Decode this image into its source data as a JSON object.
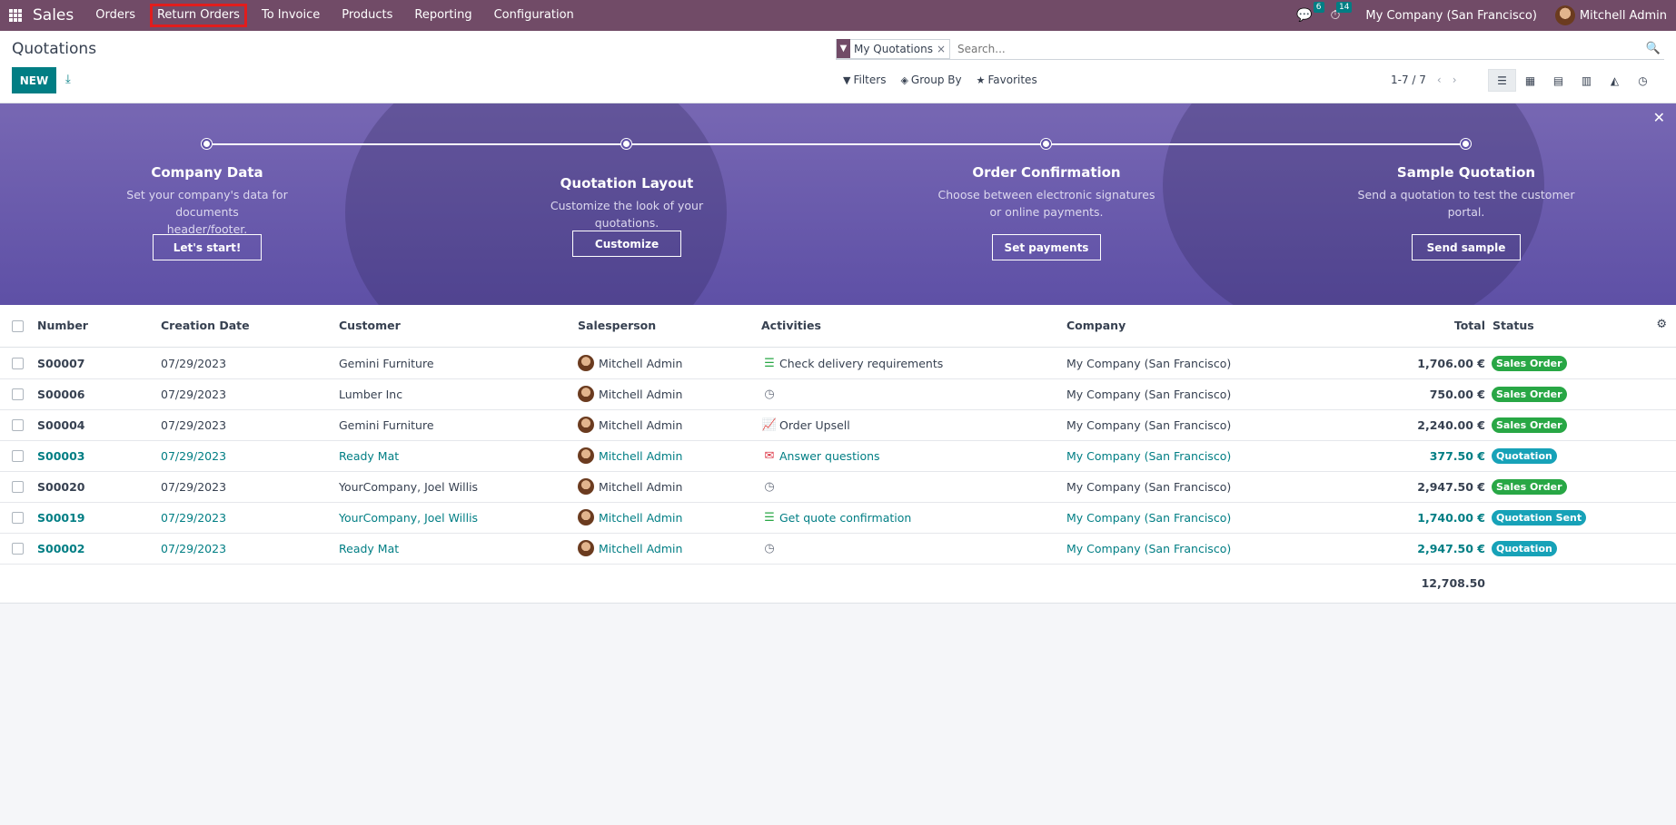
{
  "navbar": {
    "app_name": "Sales",
    "menu": [
      {
        "label": "Orders"
      },
      {
        "label": "Return Orders"
      },
      {
        "label": "To Invoice"
      },
      {
        "label": "Products"
      },
      {
        "label": "Reporting"
      },
      {
        "label": "Configuration"
      }
    ],
    "messages_count": "6",
    "activities_count": "14",
    "company": "My Company (San Francisco)",
    "user": "Mitchell Admin",
    "accent": "#714b67"
  },
  "control": {
    "title": "Quotations",
    "new_label": "NEW",
    "facet_label": "My Quotations",
    "search_placeholder": "Search...",
    "filters_label": "Filters",
    "groupby_label": "Group By",
    "favorites_label": "Favorites",
    "pager": "1-7 / 7"
  },
  "banner": {
    "steps": [
      {
        "title": "Company Data",
        "desc_line1": "Set your company's data for documents",
        "desc_line2": "header/footer.",
        "button": "Let's start!"
      },
      {
        "title": "Quotation Layout",
        "desc_line1": "Customize the look of your quotations.",
        "desc_line2": "",
        "button": "Customize"
      },
      {
        "title": "Order Confirmation",
        "desc_line1": "Choose between electronic signatures",
        "desc_line2": "or online payments.",
        "button": "Set payments"
      },
      {
        "title": "Sample Quotation",
        "desc_line1": "Send a quotation to test the customer",
        "desc_line2": "portal.",
        "button": "Send sample"
      }
    ]
  },
  "table": {
    "headers": {
      "number": "Number",
      "date": "Creation Date",
      "customer": "Customer",
      "salesperson": "Salesperson",
      "activities": "Activities",
      "company": "Company",
      "total": "Total",
      "status": "Status"
    },
    "rows": [
      {
        "number": "S00007",
        "date": "07/29/2023",
        "customer": "Gemini Furniture",
        "salesperson": "Mitchell Admin",
        "activity": "Check delivery requirements",
        "activity_icon": "list-icon",
        "company": "My Company (San Francisco)",
        "total": "1,706.00 €",
        "status": "Sales Order"
      },
      {
        "number": "S00006",
        "date": "07/29/2023",
        "customer": "Lumber Inc",
        "salesperson": "Mitchell Admin",
        "activity": "",
        "activity_icon": "clock-icon",
        "company": "My Company (San Francisco)",
        "total": "750.00 €",
        "status": "Sales Order"
      },
      {
        "number": "S00004",
        "date": "07/29/2023",
        "customer": "Gemini Furniture",
        "salesperson": "Mitchell Admin",
        "activity": "Order Upsell",
        "activity_icon": "chart-icon",
        "company": "My Company (San Francisco)",
        "total": "2,240.00 €",
        "status": "Sales Order"
      },
      {
        "number": "S00003",
        "date": "07/29/2023",
        "customer": "Ready Mat",
        "salesperson": "Mitchell Admin",
        "activity": "Answer questions",
        "activity_icon": "envelope-icon",
        "company": "My Company (San Francisco)",
        "total": "377.50 €",
        "status": "Quotation"
      },
      {
        "number": "S00020",
        "date": "07/29/2023",
        "customer": "YourCompany, Joel Willis",
        "salesperson": "Mitchell Admin",
        "activity": "",
        "activity_icon": "clock-icon",
        "company": "My Company (San Francisco)",
        "total": "2,947.50 €",
        "status": "Sales Order"
      },
      {
        "number": "S00019",
        "date": "07/29/2023",
        "customer": "YourCompany, Joel Willis",
        "salesperson": "Mitchell Admin",
        "activity": "Get quote confirmation",
        "activity_icon": "list-icon",
        "company": "My Company (San Francisco)",
        "total": "1,740.00 €",
        "status": "Quotation Sent"
      },
      {
        "number": "S00002",
        "date": "07/29/2023",
        "customer": "Ready Mat",
        "salesperson": "Mitchell Admin",
        "activity": "",
        "activity_icon": "clock-icon",
        "company": "My Company (San Francisco)",
        "total": "2,947.50 €",
        "status": "Quotation"
      }
    ],
    "grand_total": "12,708.50",
    "status_colors": {
      "Sales Order": "#28a745",
      "Quotation": "#17a2b8",
      "Quotation Sent": "#17a2b8"
    }
  }
}
